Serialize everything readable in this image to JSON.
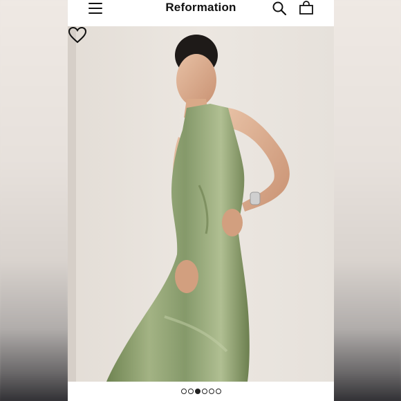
{
  "header": {
    "brand": "Reformation",
    "menu_icon": "hamburger-menu-icon",
    "search_icon": "search-icon",
    "bag_icon": "shopping-bag-icon"
  },
  "product_image": {
    "wishlist_icon": "heart-outline-icon",
    "dress_color": "#8a9c6a"
  },
  "carousel": {
    "total": 6,
    "active_index": 2
  }
}
